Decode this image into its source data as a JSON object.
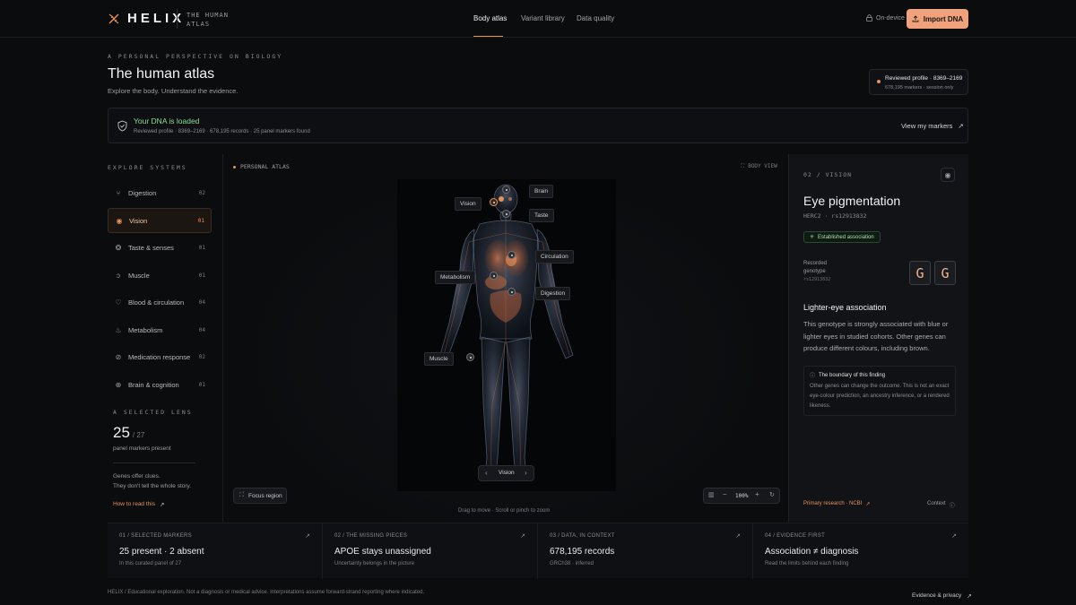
{
  "header": {
    "brand": "HELIX",
    "brand_sub": "THE HUMAN ATLAS",
    "nav": [
      "Body atlas",
      "Variant library",
      "Data quality"
    ],
    "on_device": "On-device",
    "import_label": "Import DNA"
  },
  "hero": {
    "eyebrow": "A PERSONAL PERSPECTIVE ON BIOLOGY",
    "title": "The human atlas",
    "subtitle": "Explore the body. Understand the evidence.",
    "profile_title": "Reviewed profile · 8369–2169",
    "profile_meta": "678,195 markers · session only"
  },
  "loaded": {
    "title": "Your DNA is loaded",
    "meta": "Reviewed profile · 8369–2169 · 678,195 records · 25 panel markers found",
    "link": "View my markers"
  },
  "sidebar": {
    "heading": "EXPLORE SYSTEMS",
    "items": [
      {
        "label": "Digestion",
        "count": "02",
        "icon": "utensils-icon"
      },
      {
        "label": "Vision",
        "count": "01",
        "icon": "eye-icon"
      },
      {
        "label": "Taste & senses",
        "count": "01",
        "icon": "senses-icon"
      },
      {
        "label": "Muscle",
        "count": "01",
        "icon": "muscle-icon"
      },
      {
        "label": "Blood & circulation",
        "count": "04",
        "icon": "heart-icon"
      },
      {
        "label": "Metabolism",
        "count": "04",
        "icon": "flame-icon"
      },
      {
        "label": "Medication response",
        "count": "02",
        "icon": "pill-icon"
      },
      {
        "label": "Brain & cognition",
        "count": "01",
        "icon": "brain-icon"
      }
    ],
    "lens_heading": "A SELECTED LENS",
    "lens_value": "25",
    "lens_total": "/ 27",
    "lens_label": "panel markers present",
    "clue_1": "Genes offer clues.",
    "clue_2": "They don't tell the whole story.",
    "how_to": "How to read this"
  },
  "atlas": {
    "label": "PERSONAL ATLAS",
    "view": "BODY VIEW",
    "tags": [
      "Brain",
      "Vision",
      "Taste",
      "Circulation",
      "Metabolism",
      "Digestion",
      "Muscle"
    ],
    "current": "Vision",
    "focus": "Focus region",
    "zoom": "100%",
    "hint": "Drag to move · Scroll or pinch to zoom"
  },
  "detail": {
    "eyebrow": "02 / VISION",
    "title": "Eye pigmentation",
    "gene": "HERC2 · rs12913832",
    "badge": "Established association",
    "genotype_label_1": "Recorded",
    "genotype_label_2": "genotype",
    "genotype_id": "rs12913832",
    "allele_1": "G",
    "allele_2": "G",
    "heading": "Lighter-eye association",
    "body": "This genotype is strongly associated with blue or lighter eyes in studied cohorts. Other genes can produce different colours, including brown.",
    "boundary_title": "The boundary of this finding",
    "boundary_body": "Other genes can change the outcome. This is not an exact eye-colour prediction, an ancestry inference, or a rendered likeness.",
    "source": "Primary research · NCBI",
    "context": "Context"
  },
  "stats": [
    {
      "label": "01 / SELECTED MARKERS",
      "value": "25 present · 2 absent",
      "sub": "In this curated panel of 27"
    },
    {
      "label": "02 / THE MISSING PIECES",
      "value": "APOE stays unassigned",
      "sub": "Uncertainty belongs in the picture"
    },
    {
      "label": "03 / DATA, IN CONTEXT",
      "value": "678,195 records",
      "sub": "GRCh38 · inferred"
    },
    {
      "label": "04 / EVIDENCE FIRST",
      "value": "Association ≠ diagnosis",
      "sub": "Read the limits behind each finding"
    }
  ],
  "footer": {
    "disclaimer": "HELIX / Educational exploration. Not a diagnosis or medical advice. Interpretations assume forward-strand reporting where indicated.",
    "link": "Evidence & privacy"
  },
  "colors": {
    "accent": "#e8925b",
    "background": "#0b0c0e",
    "success": "#7fd48a"
  }
}
